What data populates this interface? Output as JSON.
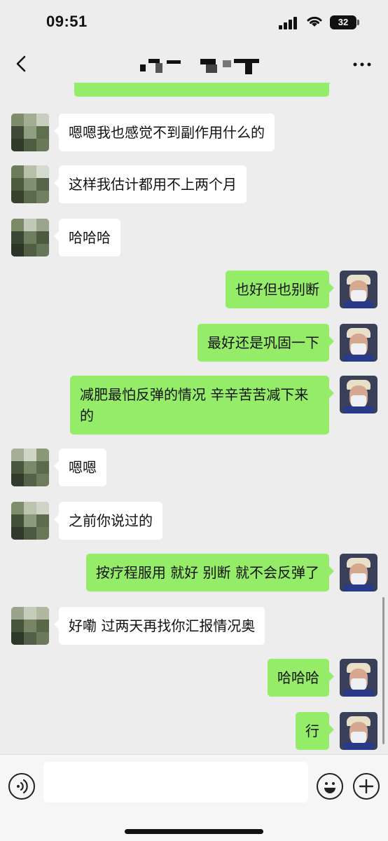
{
  "status_bar": {
    "time": "09:51",
    "battery": "32"
  },
  "nav": {
    "title": "",
    "back_icon": "chevron-left-icon",
    "more_icon": "more-dots-icon"
  },
  "messages": [
    {
      "side": "left",
      "text": "嗯嗯我也感觉不到副作用什么的"
    },
    {
      "side": "left",
      "text": "这样我估计都用不上两个月"
    },
    {
      "side": "left",
      "text": "哈哈哈"
    },
    {
      "side": "right",
      "text": "也好但也别断"
    },
    {
      "side": "right",
      "text": "最好还是巩固一下"
    },
    {
      "side": "right",
      "text": "减肥最怕反弹的情况 辛辛苦苦减下来的"
    },
    {
      "side": "left",
      "text": "嗯嗯"
    },
    {
      "side": "left",
      "text": "之前你说过的"
    },
    {
      "side": "right",
      "text": "按疗程服用 就好 别断 就不会反弹了"
    },
    {
      "side": "left",
      "text": "好嘞 过两天再找你汇报情况奥"
    },
    {
      "side": "right",
      "text": "哈哈哈"
    },
    {
      "side": "right",
      "text": "行"
    }
  ],
  "input_bar": {
    "voice_icon": "voice-icon",
    "emoji_icon": "emoji-icon",
    "plus_icon": "plus-icon",
    "placeholder": ""
  },
  "colors": {
    "background": "#ededed",
    "bubble_mine": "#95ec69",
    "bubble_other": "#ffffff"
  }
}
